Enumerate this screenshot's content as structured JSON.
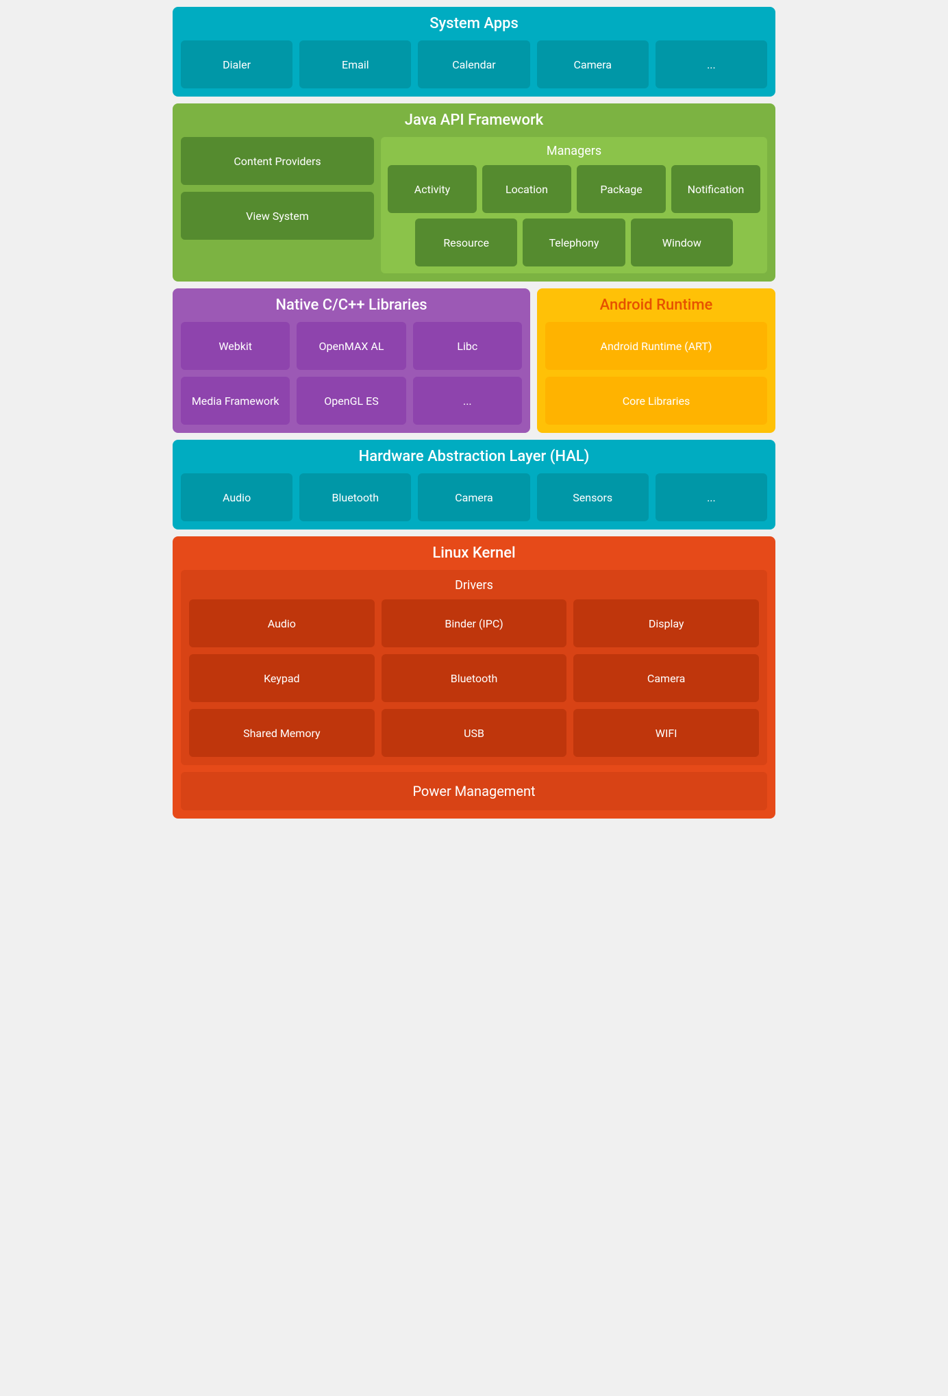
{
  "system_apps": {
    "title": "System Apps",
    "apps": [
      "Dialer",
      "Email",
      "Calendar",
      "Camera",
      "..."
    ]
  },
  "java_api": {
    "title": "Java API Framework",
    "left": {
      "content_providers": "Content Providers",
      "view_system": "View System"
    },
    "managers": {
      "title": "Managers",
      "top_row": [
        "Activity",
        "Location",
        "Package",
        "Notification"
      ],
      "bottom_row": [
        "Resource",
        "Telephony",
        "Window"
      ]
    }
  },
  "native_libs": {
    "title": "Native C/C++ Libraries",
    "items": [
      "Webkit",
      "OpenMAX AL",
      "Libc",
      "Media Framework",
      "OpenGL ES",
      "..."
    ]
  },
  "android_runtime": {
    "title": "Android Runtime",
    "items": [
      "Android Runtime (ART)",
      "Core Libraries"
    ]
  },
  "hal": {
    "title": "Hardware Abstraction Layer (HAL)",
    "items": [
      "Audio",
      "Bluetooth",
      "Camera",
      "Sensors",
      "..."
    ]
  },
  "linux_kernel": {
    "title": "Linux Kernel",
    "drivers": {
      "title": "Drivers",
      "items": [
        "Audio",
        "Binder (IPC)",
        "Display",
        "Keypad",
        "Bluetooth",
        "Camera",
        "Shared Memory",
        "USB",
        "WIFI"
      ]
    },
    "power_management": "Power Management"
  }
}
